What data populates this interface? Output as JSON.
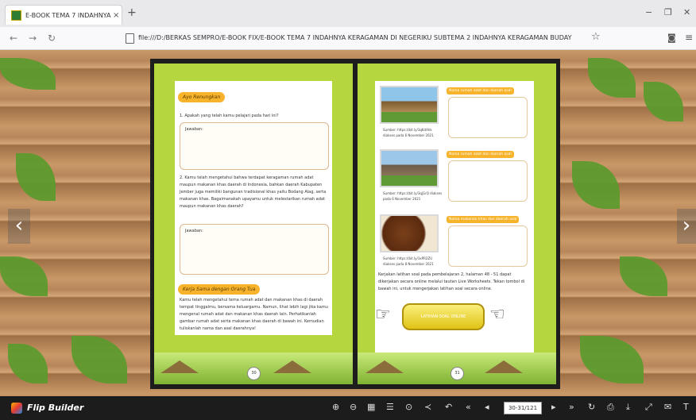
{
  "browser": {
    "tab_title": "E-BOOK TEMA 7 INDAHNYA KE",
    "tab_close": "×",
    "new_tab": "+",
    "url": "file:///D:/BERKAS SEMPRO/E-BOOK FIX/E-BOOK TEMA 7 INDAHNYA KERAGAMAN DI NEGERIKU SUBTEMA 2 INDAHNYA KERAGAMAN BUDAY",
    "minimize": "−",
    "maximize": "❐",
    "close": "✕"
  },
  "book": {
    "left": {
      "heading": "Ayo Renungkan",
      "q1": "1. Apakah yang telah kamu pelajari pada hari ini?",
      "answer1_label": "Jawaban:",
      "q2": "2. Kamu telah mengetahui bahwa terdapat keragaman rumah adat maupun makanan khas daerah di Indonesia, bahkan daerah Kabupaten Jember juga memiliki bangunan tradisional khas yaitu Bodang Alag, serta makanan khas. Bagaimanakah upayamu untuk melestarikan rumah adat maupun makanan khas daerah?",
      "answer2_label": "Jawaban:",
      "section2": "Kerja Sama dengan Orang Tua",
      "section2_text": "Kamu telah mengetahui tema rumah adat dan makanan khas di daerah tempat tinggalmu, bersama keluargamu. Namun, lihat lebih lagi jika kamu mengenal rumah adat dan makanan khas daerah lain. Perhatikanlah gambar rumah adat serta makanan khas daerah di bawah ini. Kemudian tuliskanlah nama dan asal daerahnya!",
      "page_number": "30"
    },
    "right": {
      "tag1": "Nama rumah adat dan daerah asal",
      "tag2": "Nama rumah adat dan daerah asal",
      "tag3": "Nama makanan khas dan daerah asal",
      "src1": "Sumber: https://bit.ly/3qKdAhk diakses pada 6 November 2021",
      "src2": "Sumber: https://bit.ly/3qjGrQ diakses pada 6 November 2021",
      "src3": "Sumber: https://bit.ly/3xPR2ZU diakses pada 8 November 2021",
      "instruction": "Kerjakan latihan soal pada pembelajaran 2, halaman 48 - 51 dapat dikerjakan secara online melalui tautan Live Worksheets. Tekan tombol di bawah ini, untuk mengerjakan latihan soal secara online.",
      "button_label": "LATIHAN SOAL ONLINE",
      "page_number": "31"
    }
  },
  "toolbar": {
    "brand": "Flip Builder",
    "page_value": "30-31/121",
    "icons": [
      "zoom-in-icon",
      "zoom-out-icon",
      "thumbnails-icon",
      "toc-icon",
      "autoplay-icon",
      "share-icon",
      "undo-icon",
      "first-page-icon",
      "prev-page-icon",
      "next-page-icon",
      "last-page-icon",
      "refresh-icon",
      "print-icon",
      "download-icon",
      "fullscreen-icon",
      "email-icon",
      "text-icon"
    ]
  }
}
